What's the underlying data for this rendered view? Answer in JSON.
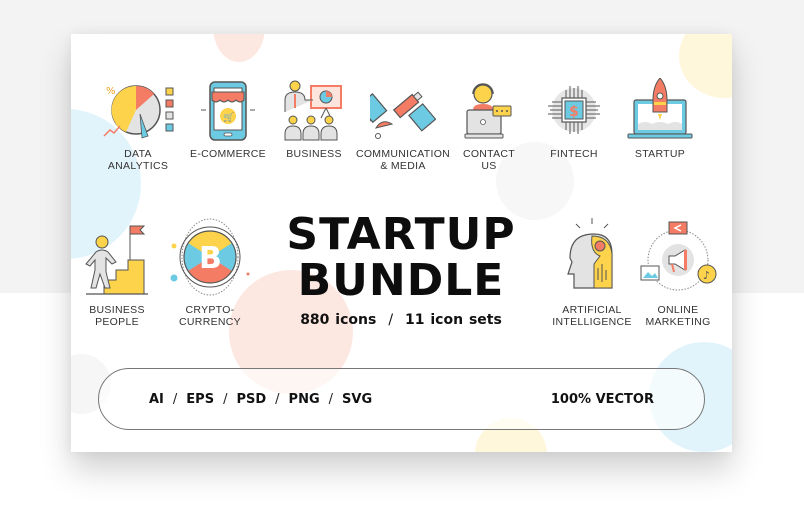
{
  "colors": {
    "yellow": "#fcd34a",
    "coral": "#f47c65",
    "blue": "#6ccbe3",
    "grey": "#e3e3e3",
    "stroke": "#555555"
  },
  "top_icons": [
    {
      "icon": "pie-chart-icon",
      "label": "DATA\nANALYTICS"
    },
    {
      "icon": "smartphone-shop-icon",
      "label": "E-COMMERCE"
    },
    {
      "icon": "presentation-icon",
      "label": "BUSINESS"
    },
    {
      "icon": "satellite-icon",
      "label": "COMMUNICATION\n& MEDIA"
    },
    {
      "icon": "support-agent-icon",
      "label": "CONTACT\nUS"
    },
    {
      "icon": "dollar-chip-icon",
      "label": "FINTECH"
    },
    {
      "icon": "rocket-laptop-icon",
      "label": "STARTUP"
    }
  ],
  "left_icons": [
    {
      "icon": "stairs-flag-icon",
      "label": "BUSINESS\nPEOPLE"
    },
    {
      "icon": "bitcoin-icon",
      "label": "CRYPTO-\nCURRENCY"
    }
  ],
  "right_icons": [
    {
      "icon": "ai-head-icon",
      "label": "ARTIFICIAL\nINTELLIGENCE"
    },
    {
      "icon": "megaphone-icon",
      "label": "ONLINE\nMARKETING"
    }
  ],
  "title": {
    "line1": "STARTUP",
    "line2": "BUNDLE"
  },
  "subtitle": {
    "icons_count": "880 icons",
    "separator": "/",
    "sets_count": "11 icon sets"
  },
  "formats": {
    "items": [
      "AI",
      "EPS",
      "PSD",
      "PNG",
      "SVG"
    ],
    "separator": "/",
    "vector_label": "100% VECTOR"
  }
}
